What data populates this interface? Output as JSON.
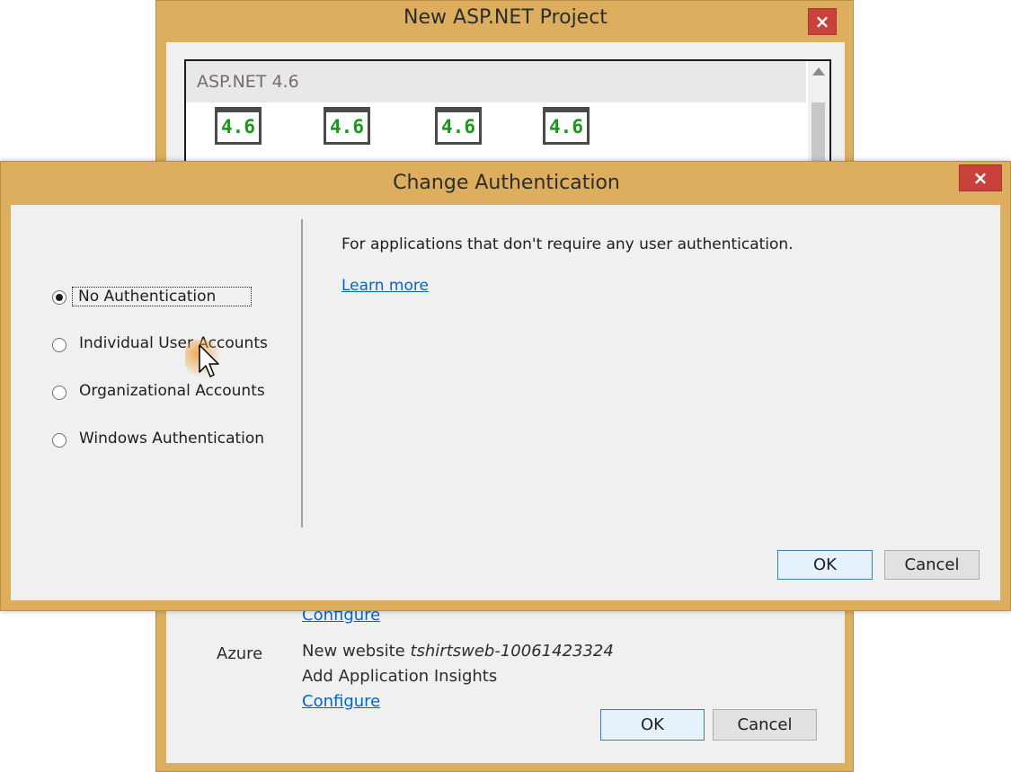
{
  "back_window": {
    "title": "New ASP.NET Project",
    "close_glyph": "×",
    "template_version": "ASP.NET 4.6",
    "template_icons": [
      "4.6",
      "4.6",
      "4.6",
      "4.6"
    ],
    "azure": {
      "label": "Azure",
      "website_prefix": "New website",
      "website_name": "tshirtsweb-10061423324",
      "insights": "Add Application Insights",
      "configure_top": "Configure",
      "configure_bottom": "Configure"
    },
    "ok_label": "OK",
    "cancel_label": "Cancel"
  },
  "auth_dialog": {
    "title": "Change Authentication",
    "close_glyph": "×",
    "options": [
      {
        "label": "No Authentication",
        "selected": true
      },
      {
        "label": "Individual User Accounts",
        "selected": false
      },
      {
        "label": "Organizational Accounts",
        "selected": false
      },
      {
        "label": "Windows Authentication",
        "selected": false
      }
    ],
    "description": "For applications that don't require any user authentication.",
    "learn_more": "Learn more",
    "ok_label": "OK",
    "cancel_label": "Cancel"
  },
  "colors": {
    "frame": "#dcae5e",
    "close_red": "#c9413b",
    "link": "#0066cc",
    "template_green": "#1a9a1a"
  }
}
